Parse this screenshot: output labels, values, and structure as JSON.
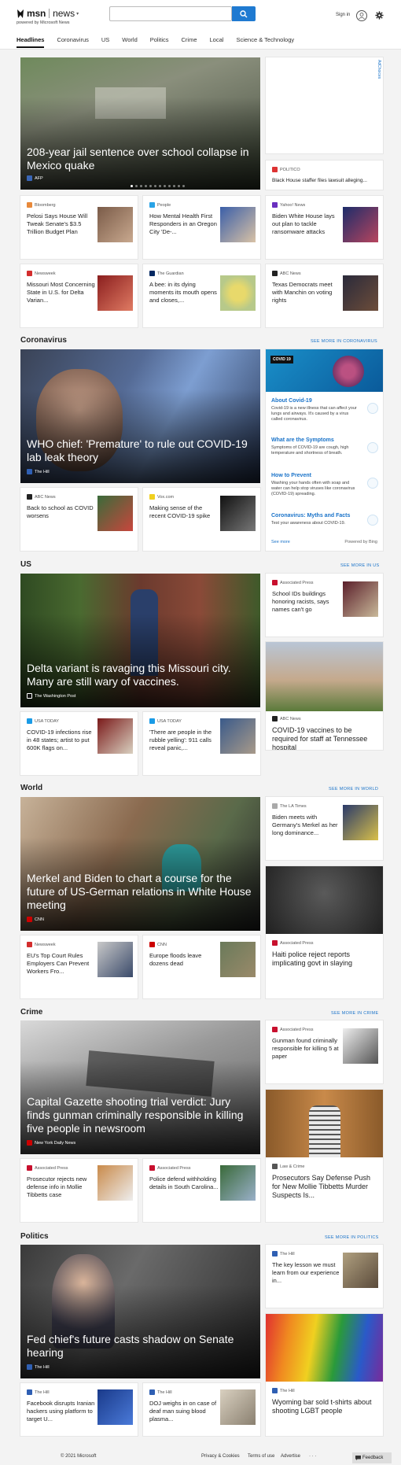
{
  "header": {
    "brand": "msn",
    "product": "news",
    "powered_by": "powered by Microsoft News",
    "search_placeholder": "",
    "signin": "Sign in"
  },
  "nav": [
    "Headlines",
    "Coronavirus",
    "US",
    "World",
    "Politics",
    "Crime",
    "Local",
    "Science & Technology"
  ],
  "ad_label": "AdChoices",
  "headlines": {
    "hero": {
      "title": "208-year jail sentence over school collapse in Mexico quake",
      "source": "AFP"
    },
    "side": {
      "source": "POLITICO",
      "title": "Black House staffer files lawsuit alleging..."
    },
    "cards": [
      {
        "source": "Bloomberg",
        "title": "Pelosi Says House Will Tweak Senate's $3.5 Trillion Budget Plan"
      },
      {
        "source": "People",
        "title": "How Mental Health First Responders in an Oregon City 'De-..."
      },
      {
        "source": "Yahoo! News",
        "title": "Biden White House lays out plan to tackle ransomware attacks"
      },
      {
        "source": "Newsweek",
        "title": "Missouri Most Concerning State in U.S. for Delta Varian..."
      },
      {
        "source": "The Guardian",
        "title": "A bee: in its dying moments its mouth opens and closes,..."
      },
      {
        "source": "ABC News",
        "title": "Texas Democrats meet with Manchin on voting rights"
      }
    ]
  },
  "coronavirus": {
    "title": "Coronavirus",
    "see_more": "SEE MORE IN CORONAVIRUS",
    "hero": {
      "title": "WHO chief: 'Premature' to rule out COVID-19 lab leak theory",
      "source": "The Hill"
    },
    "cards": [
      {
        "source": "ABC News",
        "title": "Back to school as COVID worsens"
      },
      {
        "source": "Vox.com",
        "title": "Making sense of the recent COVID-19 spike"
      }
    ],
    "panel": {
      "badge": "COVID 19",
      "items": [
        {
          "title": "About Covid-19",
          "desc": "Covid-19 is a new illness that can affect your lungs and airways. It's caused by a virus called coronavirus."
        },
        {
          "title": "What are the Symptoms",
          "desc": "Symptoms of COVID-19 are cough, high temperature and shortness of breath."
        },
        {
          "title": "How to Prevent",
          "desc": "Washing your hands often with soap and water can help stop viruses like coronavirus (COVID-19) spreading."
        },
        {
          "title": "Coronavirus: Myths and Facts",
          "desc": "Test your awareness about COVID-19."
        }
      ],
      "see_more": "See more",
      "powered": "Powered by Bing"
    }
  },
  "us": {
    "title": "US",
    "see_more": "SEE MORE IN US",
    "hero": {
      "title": "Delta variant is ravaging this Missouri city. Many are still wary of vaccines.",
      "source": "The Washington Post"
    },
    "side_top": {
      "source": "Associated Press",
      "title": "School IDs buildings honoring racists, says names can't go"
    },
    "side_big": {
      "source": "ABC News",
      "title": "COVID-19 vaccines to be required for staff at Tennessee hospital"
    },
    "cards": [
      {
        "source": "USA TODAY",
        "title": "COVID-19 infections rise in 48 states; artist to put 600K flags on..."
      },
      {
        "source": "USA TODAY",
        "title": "'There are people in the rubble yelling': 911 calls reveal panic,..."
      }
    ]
  },
  "world": {
    "title": "World",
    "see_more": "SEE MORE IN WORLD",
    "hero": {
      "title": "Merkel and Biden to chart a course for the future of US-German relations in White House meeting",
      "source": "CNN"
    },
    "side_top": {
      "source": "The LA Times",
      "title": "Biden meets with Germany's Merkel as her long dominance..."
    },
    "side_big": {
      "source": "Associated Press",
      "title": "Haiti police reject reports implicating govt in slaying"
    },
    "cards": [
      {
        "source": "Newsweek",
        "title": "EU's Top Court Rules Employers Can Prevent Workers Fro..."
      },
      {
        "source": "CNN",
        "title": "Europe floods leave dozens dead"
      }
    ]
  },
  "crime": {
    "title": "Crime",
    "see_more": "SEE MORE IN CRIME",
    "hero": {
      "title": "Capital Gazette shooting trial verdict: Jury finds gunman criminally responsible in killing five people in newsroom",
      "source": "New York Daily News"
    },
    "side_top": {
      "source": "Associated Press",
      "title": "Gunman found criminally responsible for killing 5 at paper"
    },
    "side_big": {
      "source": "Law & Crime",
      "title": "Prosecutors Say Defense Push for New Mollie Tibbetts Murder Suspects Is..."
    },
    "cards": [
      {
        "source": "Associated Press",
        "title": "Prosecutor rejects new defense info in Mollie Tibbetts case"
      },
      {
        "source": "Associated Press",
        "title": "Police defend withholding details in South Carolina..."
      }
    ]
  },
  "politics": {
    "title": "Politics",
    "see_more": "SEE MORE IN POLITICS",
    "hero": {
      "title": "Fed chief's future casts shadow on Senate hearing",
      "source": "The Hill"
    },
    "side_top": {
      "source": "The Hill",
      "title": "The key lesson we must learn from our experience in..."
    },
    "side_big": {
      "source": "The Hill",
      "title": "Wyoming bar sold t-shirts about shooting LGBT people"
    },
    "cards": [
      {
        "source": "The Hill",
        "title": "Facebook disrupts Iranian hackers using platform to target U..."
      },
      {
        "source": "The Hill",
        "title": "DOJ weighs in on case of deaf man suing blood plasma..."
      }
    ]
  },
  "footer": {
    "copyright": "© 2021 Microsoft",
    "privacy": "Privacy & Cookies",
    "terms": "Terms of use",
    "advertise": "Advertise",
    "more": "· · ·",
    "feedback": "Feedback"
  }
}
